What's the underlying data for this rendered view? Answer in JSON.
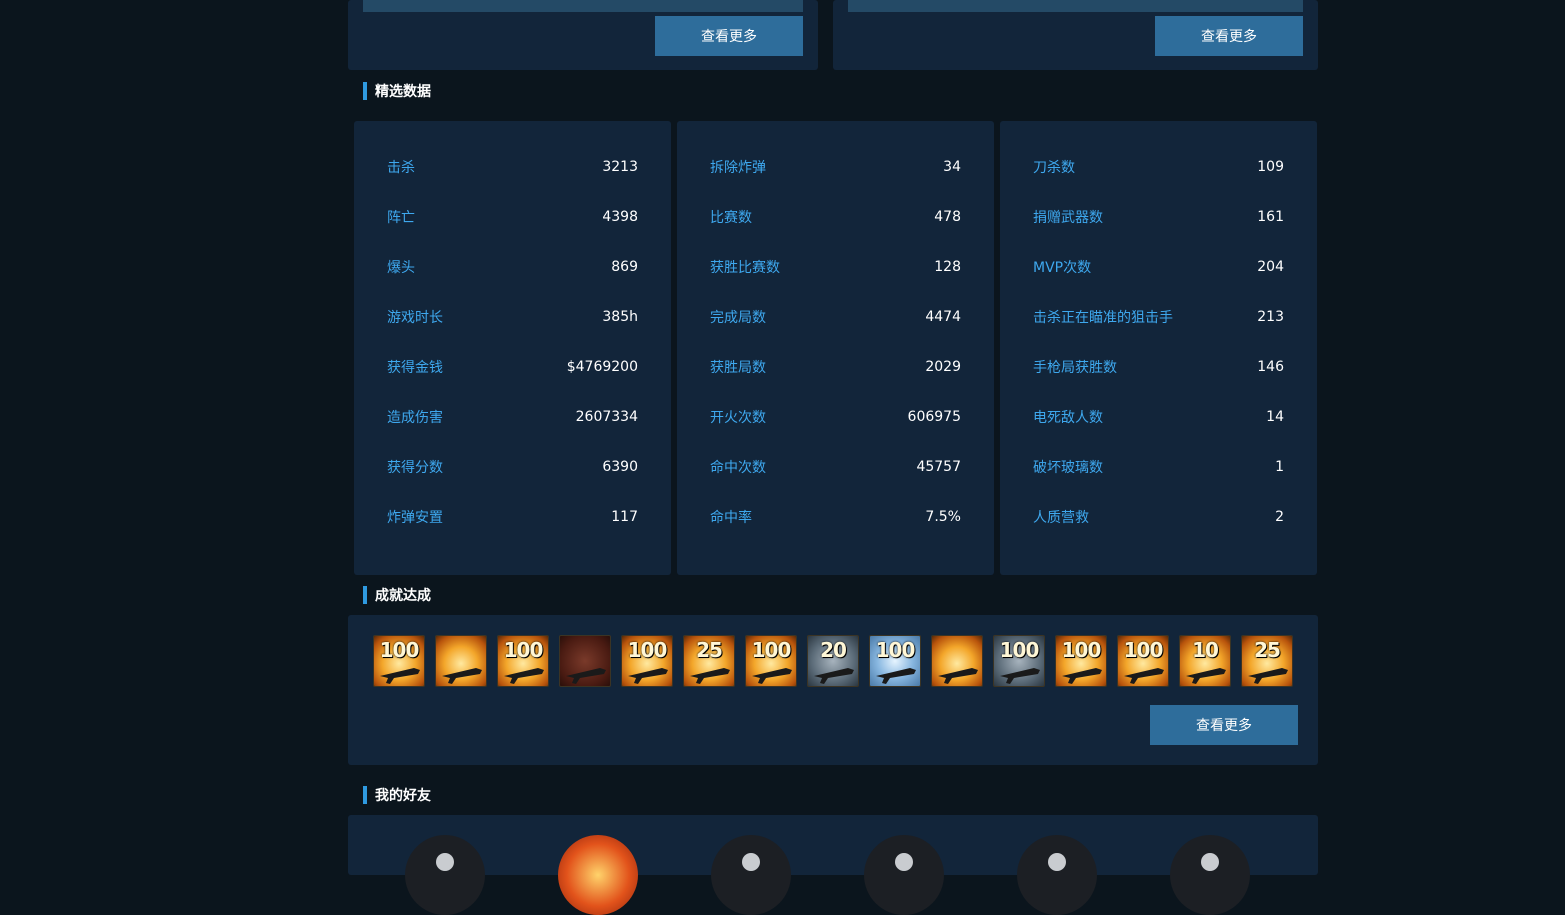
{
  "top_panels": [
    {
      "view_more": "查看更多"
    },
    {
      "view_more": "查看更多"
    }
  ],
  "featured": {
    "title": "精选数据",
    "columns": [
      [
        {
          "label": "击杀",
          "value": "3213"
        },
        {
          "label": "阵亡",
          "value": "4398"
        },
        {
          "label": "爆头",
          "value": "869"
        },
        {
          "label": "游戏时长",
          "value": "385h"
        },
        {
          "label": "获得金钱",
          "value": "$4769200"
        },
        {
          "label": "造成伤害",
          "value": "2607334"
        },
        {
          "label": "获得分数",
          "value": "6390"
        },
        {
          "label": "炸弹安置",
          "value": "117"
        }
      ],
      [
        {
          "label": "拆除炸弹",
          "value": "34"
        },
        {
          "label": "比赛数",
          "value": "478"
        },
        {
          "label": "获胜比赛数",
          "value": "128"
        },
        {
          "label": "完成局数",
          "value": "4474"
        },
        {
          "label": "获胜局数",
          "value": "2029"
        },
        {
          "label": "开火次数",
          "value": "606975"
        },
        {
          "label": "命中次数",
          "value": "45757"
        },
        {
          "label": "命中率",
          "value": "7.5%"
        }
      ],
      [
        {
          "label": "刀杀数",
          "value": "109"
        },
        {
          "label": "捐赠武器数",
          "value": "161"
        },
        {
          "label": "MVP次数",
          "value": "204"
        },
        {
          "label": "击杀正在瞄准的狙击手",
          "value": "213"
        },
        {
          "label": "手枪局获胜数",
          "value": "146"
        },
        {
          "label": "电死敌人数",
          "value": "14"
        },
        {
          "label": "破坏玻璃数",
          "value": "1"
        },
        {
          "label": "人质营救",
          "value": "2"
        }
      ]
    ]
  },
  "achievements": {
    "title": "成就达成",
    "icons": [
      {
        "icon": "rifle-100-icon",
        "style": "gold",
        "text": "100"
      },
      {
        "icon": "sniper-target-icon",
        "style": "gold",
        "text": ""
      },
      {
        "icon": "sniper-rifle-100-icon",
        "style": "gold",
        "text": "100"
      },
      {
        "icon": "grenade-icon",
        "style": "red",
        "text": ""
      },
      {
        "icon": "knife-100-icon",
        "style": "gold",
        "text": "100"
      },
      {
        "icon": "smg-25-icon",
        "style": "gold",
        "text": "25"
      },
      {
        "icon": "bomb-100-icon",
        "style": "gold",
        "text": "100"
      },
      {
        "icon": "defuse-20-icon",
        "style": "gray",
        "text": "20"
      },
      {
        "icon": "play-100-icon",
        "style": "blue",
        "text": "100"
      },
      {
        "icon": "crosshair-terrorist-icon",
        "style": "gold",
        "text": ""
      },
      {
        "icon": "medal-100-icon",
        "style": "gray",
        "text": "100"
      },
      {
        "icon": "rifle-100-icon",
        "style": "gold",
        "text": "100"
      },
      {
        "icon": "crosshair-rifle-100-icon",
        "style": "gold",
        "text": "100"
      },
      {
        "icon": "pistol-10-icon",
        "style": "gold",
        "text": "10"
      },
      {
        "icon": "pistol-25-icon",
        "style": "gold",
        "text": "25"
      }
    ],
    "view_more": "查看更多"
  },
  "friends": {
    "title": "我的好友",
    "avatars": [
      "default-avatar",
      "fire-avatar",
      "default-avatar",
      "default-avatar",
      "default-avatar",
      "default-avatar"
    ]
  }
}
